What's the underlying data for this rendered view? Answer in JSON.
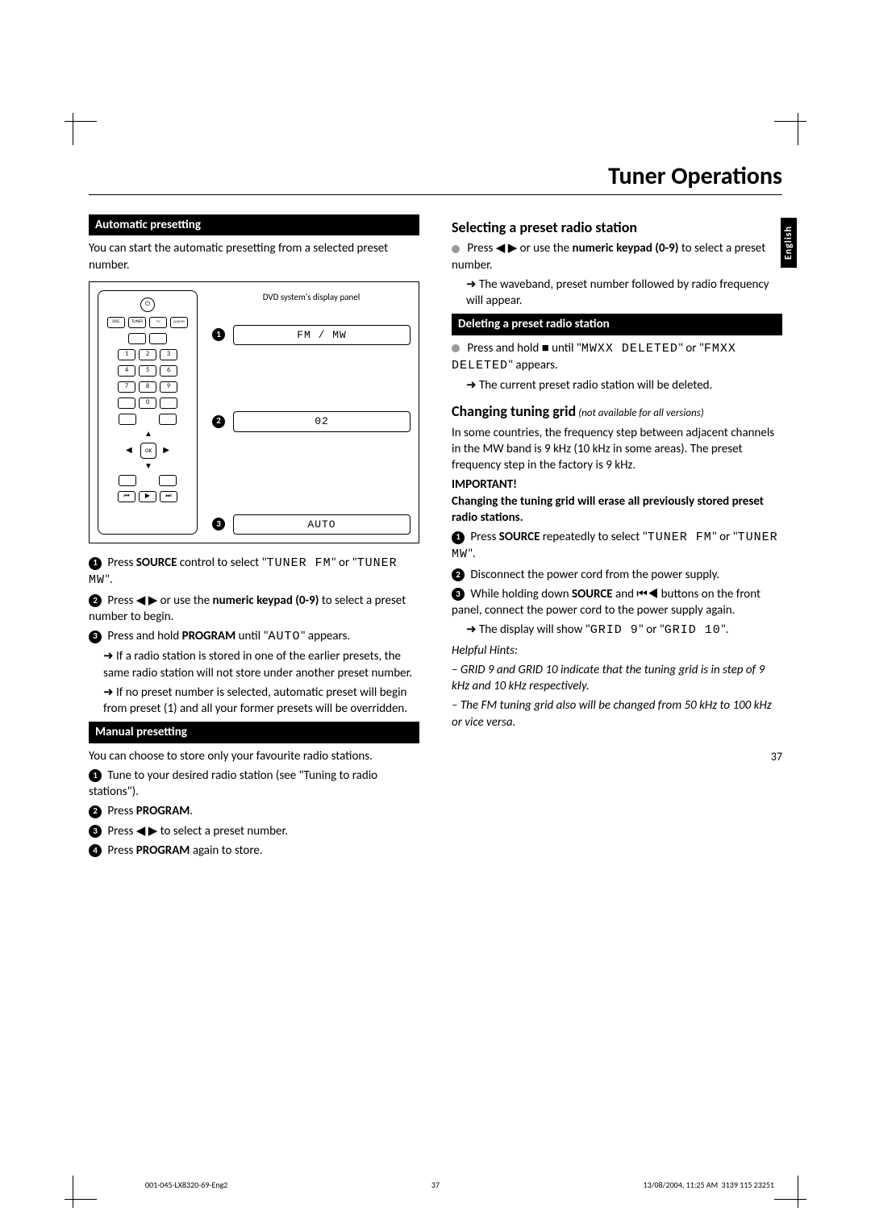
{
  "page_title": "Tuner Operations",
  "side_tab": "English",
  "page_number": "37",
  "left": {
    "auto_heading": "Automatic presetting",
    "auto_intro": "You can start the automatic presetting from a selected preset number.",
    "diagram": {
      "caption": "DVD system's display panel",
      "d1": "FM / MW",
      "d2": "02",
      "d3": "AUTO",
      "ok": "OK"
    },
    "auto_step1a": "Press ",
    "auto_step1b": "SOURCE",
    "auto_step1c": " control to select \"",
    "auto_step1d": "TUNER FM",
    "auto_step1e": "\" or \"",
    "auto_step1f": "TUNER MW",
    "auto_step1g": "\".",
    "auto_step2a": "Press ◀ ▶ or use the ",
    "auto_step2b": "numeric keypad (0-9)",
    "auto_step2c": " to select a preset number to begin.",
    "auto_step3a": "Press and hold ",
    "auto_step3b": "PROGRAM",
    "auto_step3c": " until \"",
    "auto_step3d": "AUTO",
    "auto_step3e": "\" appears.",
    "auto_note1": "➜ If a radio station is stored in one of the earlier presets, the same radio station will not store under another preset number.",
    "auto_note2": "➜ If no preset number is selected, automatic preset will begin from preset (1) and all your former presets will be overridden.",
    "manual_heading": "Manual presetting",
    "manual_intro": "You can choose to store only your favourite radio stations.",
    "manual_step1": "Tune to your desired radio station (see \"Tuning to radio stations\").",
    "manual_step2a": "Press ",
    "manual_step2b": "PROGRAM",
    "manual_step2c": ".",
    "manual_step3": "Press ◀ ▶ to select a preset number.",
    "manual_step4a": "Press ",
    "manual_step4b": "PROGRAM",
    "manual_step4c": " again to store."
  },
  "right": {
    "select_heading": "Selecting a preset radio station",
    "select_b1a": "Press ◀ ▶ or use the ",
    "select_b1b": "numeric keypad (0-9)",
    "select_b1c": " to select a preset number.",
    "select_note": "➜ The waveband, preset number followed by radio frequency will appear.",
    "delete_heading": "Deleting a preset radio station",
    "delete_b1a": "Press and hold ■ until \"",
    "delete_b1b": "MWXX DELETED",
    "delete_b1c": "\" or \"",
    "delete_b1d": "FMXX DELETED",
    "delete_b1e": "\" appears.",
    "delete_note": "➜ The current preset radio station will be deleted.",
    "grid_heading": "Changing tuning grid",
    "grid_note_italic": " (not available for all versions)",
    "grid_intro": "In some countries, the frequency step between adjacent channels in the MW band is 9 kHz (10 kHz in some areas). The preset frequency step in the factory is 9 kHz.",
    "important_label": "IMPORTANT!",
    "important_text": "Changing the tuning grid will erase all previously stored preset radio stations.",
    "grid_step1a": "Press ",
    "grid_step1b": "SOURCE",
    "grid_step1c": " repeatedly to select \"",
    "grid_step1d": "TUNER FM",
    "grid_step1e": "\" or \"",
    "grid_step1f": "TUNER MW",
    "grid_step1g": "\".",
    "grid_step2": "Disconnect the power cord from the power supply.",
    "grid_step3a": "While holding down ",
    "grid_step3b": "SOURCE",
    "grid_step3c": " and ⏮◀ buttons on the front panel, connect the power cord to the power supply again.",
    "grid_step3d": "➜ The display will show \"",
    "grid_step3e": "GRID 9",
    "grid_step3f": "\" or \"",
    "grid_step3g": "GRID 10",
    "grid_step3h": "\".",
    "hints_label": "Helpful Hints:",
    "hints1": "– GRID 9 and GRID 10 indicate that the tuning grid is in step of 9 kHz and 10 kHz respectively.",
    "hints2": "– The FM tuning grid also will be changed from 50 kHz to 100 kHz or vice versa."
  },
  "footer": {
    "left": "001-045-LX8320-69-Eng2",
    "center": "37",
    "right_time": "13/08/2004, 11:25 AM",
    "right_code": "3139 115 23251"
  }
}
